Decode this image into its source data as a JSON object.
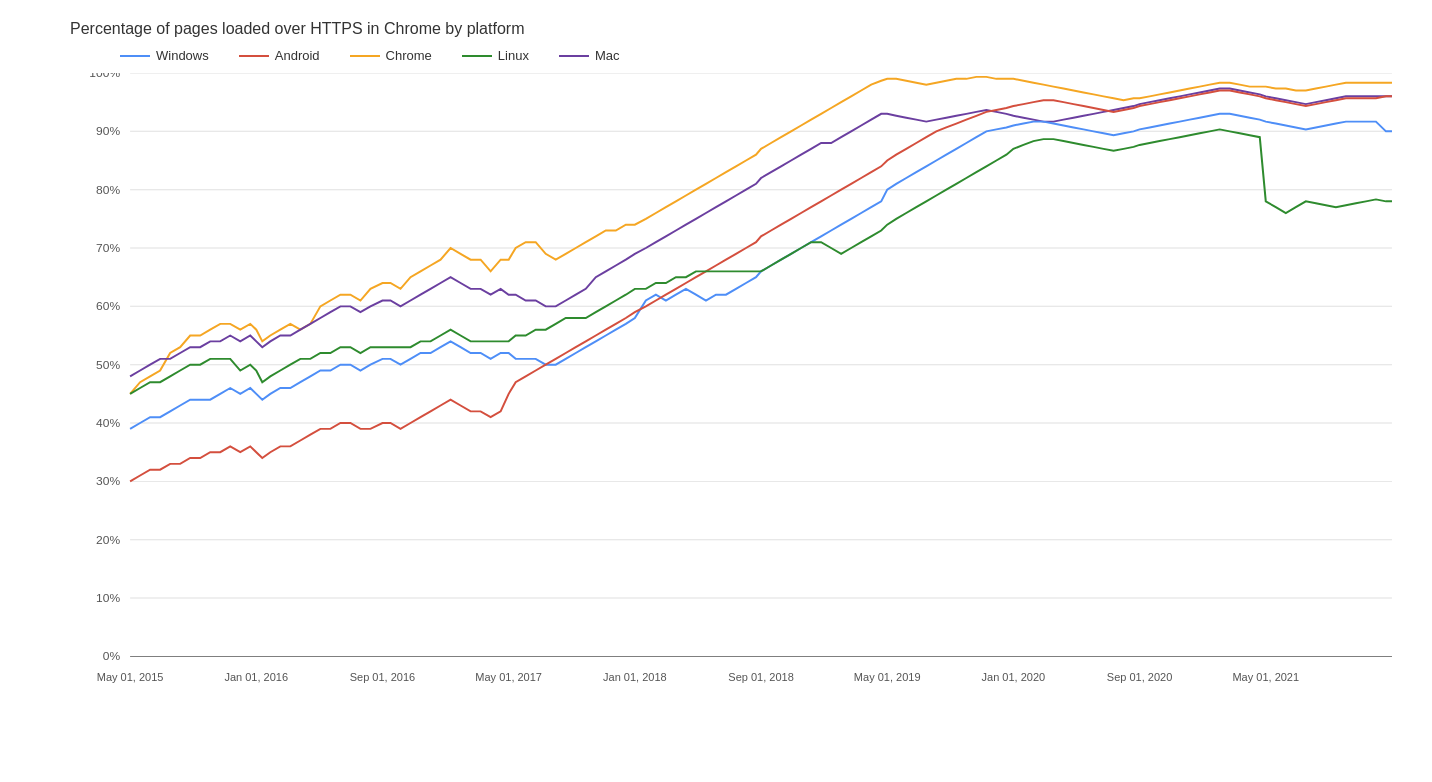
{
  "title": "Percentage of pages loaded over HTTPS in Chrome by platform",
  "legend": [
    {
      "label": "Windows",
      "color": "#4e8ef7"
    },
    {
      "label": "Android",
      "color": "#d44f3e"
    },
    {
      "label": "Chrome",
      "color": "#f5a623"
    },
    {
      "label": "Linux",
      "color": "#2e8b2e"
    },
    {
      "label": "Mac",
      "color": "#6b3fa0"
    }
  ],
  "yAxis": {
    "labels": [
      "100%",
      "90%",
      "80%",
      "70%",
      "60%",
      "50%",
      "40%",
      "30%",
      "20%",
      "10%",
      "0%"
    ]
  },
  "xAxis": {
    "labels": [
      "May 01, 2015",
      "Jan 01, 2016",
      "Sep 01, 2016",
      "May 01, 2017",
      "Jan 01, 2018",
      "Sep 01, 2018",
      "May 01, 2019",
      "Jan 01, 2020",
      "Sep 01, 2020",
      "May 01, 2021"
    ]
  }
}
